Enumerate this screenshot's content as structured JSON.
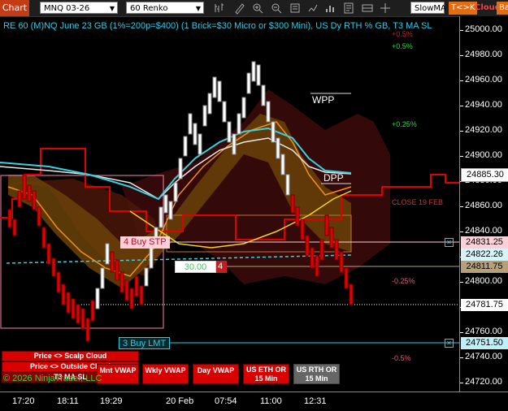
{
  "toolbar": {
    "chart_button": "Chart",
    "instrument": "MNQ 03-26",
    "bar_type": "60 Renko",
    "indicator_select": "SlowMA",
    "tc_button": "T<>K",
    "cloud_button": "Cloud",
    "bar_button": "Bar",
    "icons": [
      "bar-style-icon",
      "drawing-tools-icon",
      "zoom-in-icon",
      "zoom-out-icon",
      "properties-icon",
      "strategy-icon",
      "indicators-icon",
      "templates-icon",
      "data-box-icon",
      "crosshair-icon"
    ]
  },
  "chart": {
    "title": "RE 60 (M)NQ June 23 GB (1%=200p=$400) (1 Brick=$30 Micro or $300 Mini), US Dy RTH % GB, T3 MA SL",
    "percent_levels": [
      "+0.5%",
      "+0.25%",
      "-0.25%",
      "-0.5%"
    ],
    "top_level_label": "+0.5%",
    "close_label": "CLOSE 19 FEB",
    "wpp_label": "WPP",
    "dpp_label": "DPP",
    "buy_stop_label": "4 Buy STP",
    "buy_stop_qty_box": "30.00",
    "buy_stop_qty_count": "4",
    "buy_limit_label": "3 Buy LMT",
    "copyright": "© 2026 NinjaTrader, LLC"
  },
  "price_axis": {
    "ticks": [
      "25000.00",
      "24980.00",
      "24960.00",
      "24940.00",
      "24920.00",
      "24900.00",
      "24880.00",
      "24860.00",
      "24840.00",
      "24820.00",
      "24800.00",
      "24780.00",
      "24760.00",
      "24740.00",
      "24720.00"
    ],
    "labels": {
      "current": "24885.30",
      "stop": "24831.25",
      "vwap": "24822.26",
      "position": "24811.75",
      "crosshair": "24781.75",
      "limit": "24751.50",
      "bottom": "24720.00"
    }
  },
  "time_axis": {
    "ticks": [
      "17:20",
      "18:11",
      "19:29",
      "20 Feb",
      "07:54",
      "11:00",
      "12:31"
    ]
  },
  "buttons": {
    "scalp_cloud": "Price <> Scalp Cloud",
    "outside_cloud": "Price <> Outside Cloud",
    "t3_ma_sl": "T3 MA SL",
    "mnt_vwap": "Mnt VWAP",
    "wkly_vwap": "Wkly VWAP",
    "day_vwap": "Day VWAP",
    "us_eth_or": "US ETH OR 15 Min",
    "us_rth_or": "US RTH OR 15 Min"
  },
  "colors": {
    "background": "#000000",
    "bull_brick": "#ffffff",
    "bear_brick": "#e00000",
    "title": "#2ecbe8",
    "accent": "#c43b14",
    "buy_label": "#ffd0d8",
    "vwap_cyan": "#39d0e0"
  }
}
